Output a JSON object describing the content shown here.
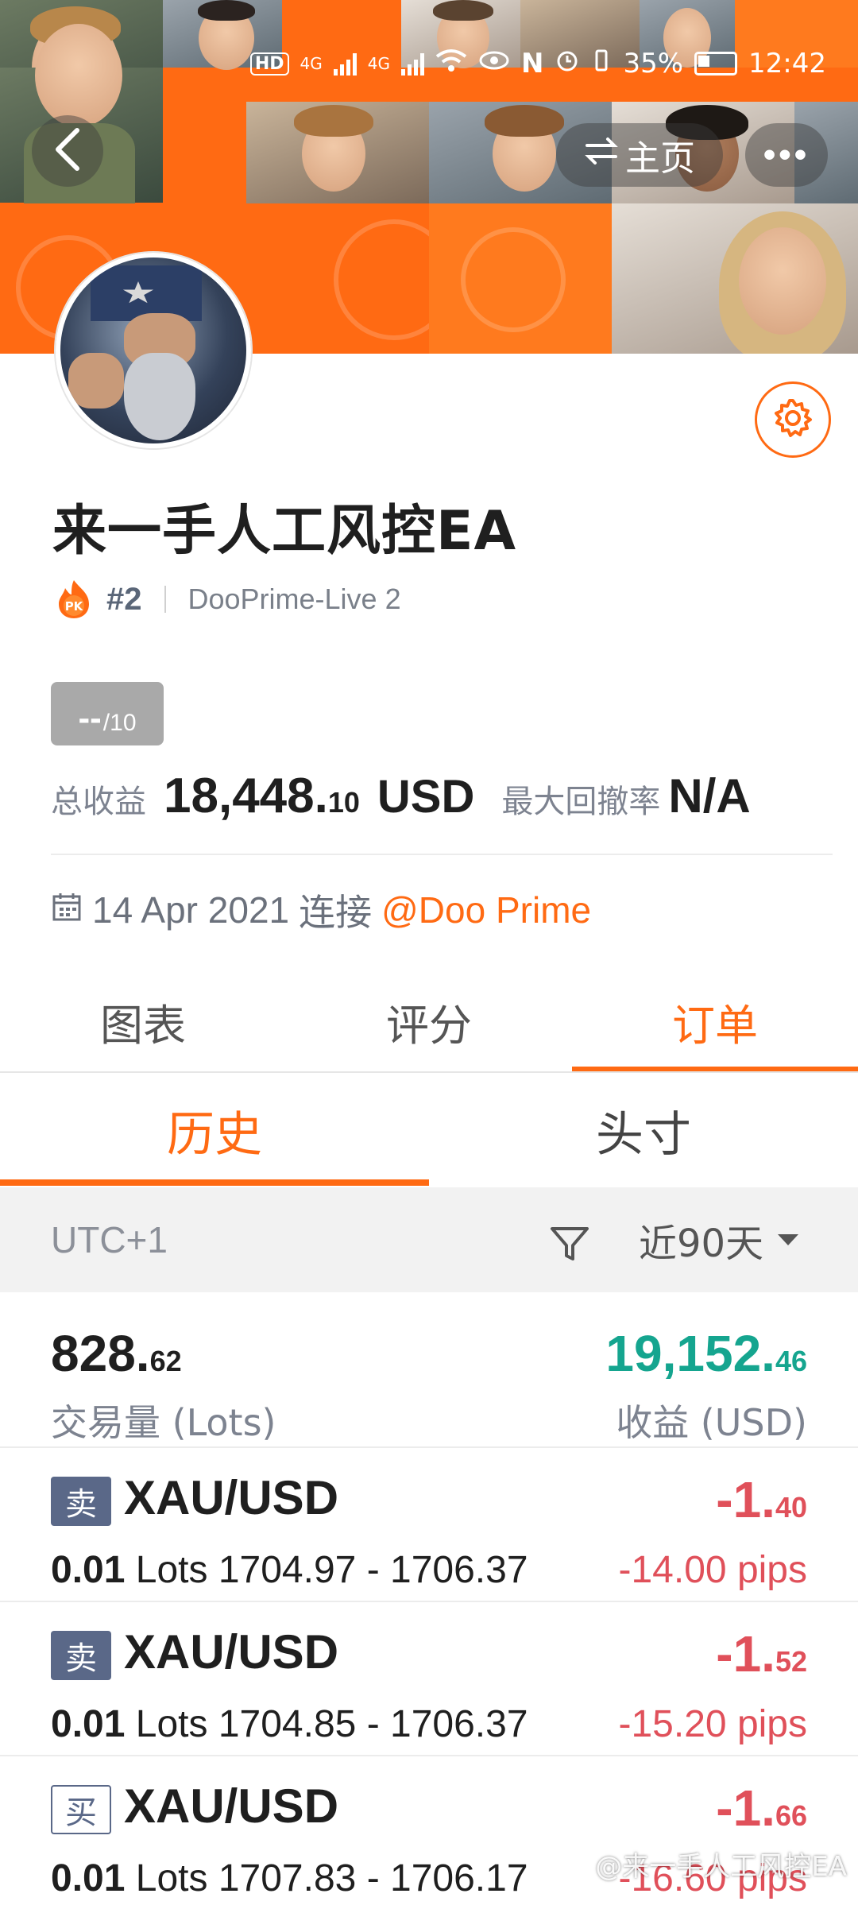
{
  "status_bar": {
    "hd": "HD",
    "sim1": "4G",
    "sim2": "4G",
    "nfc": "N",
    "battery": "35%",
    "time": "12:42"
  },
  "header": {
    "home_label": "主页",
    "more_label": "•••"
  },
  "profile": {
    "name": "来一手人工风控EA",
    "rank": "#2",
    "server": "DooPrime-Live 2",
    "score_value": "--",
    "score_max": "/10",
    "total_profit_label": "总收益",
    "total_profit_int": "18,448.",
    "total_profit_frac": "10",
    "total_profit_unit": "USD",
    "max_drawdown_label": "最大回撤率",
    "max_drawdown_value": "N/A",
    "connect_date": "14 Apr 2021",
    "connect_label": "连接",
    "connect_broker": "@Doo Prime"
  },
  "tabs": {
    "main": [
      "图表",
      "评分",
      "订单"
    ],
    "active_main": 2,
    "sub": [
      "历史",
      "头寸"
    ],
    "active_sub": 0
  },
  "filter": {
    "timezone": "UTC+1",
    "range": "近90天"
  },
  "summary": {
    "volume_int": "828.",
    "volume_frac": "62",
    "volume_label": "交易量 (Lots)",
    "profit_int": "19,152.",
    "profit_frac": "46",
    "profit_label": "收益 (USD)"
  },
  "orders": [
    {
      "side": "卖",
      "symbol": "XAU/USD",
      "lots": "0.01",
      "lots_unit": "Lots",
      "prices": "1704.97 - 1706.37",
      "profit_int": "-1.",
      "profit_frac": "40",
      "pips": "-14.00 pips"
    },
    {
      "side": "卖",
      "symbol": "XAU/USD",
      "lots": "0.01",
      "lots_unit": "Lots",
      "prices": "1704.85 - 1706.37",
      "profit_int": "-1.",
      "profit_frac": "52",
      "pips": "-15.20 pips"
    },
    {
      "side": "买",
      "symbol": "XAU/USD",
      "lots": "0.01",
      "lots_unit": "Lots",
      "prices": "1707.83 - 1706.17",
      "profit_int": "-1.",
      "profit_frac": "66",
      "pips": "-16.60 pips"
    }
  ],
  "watermark": "@来一手人工风控EA",
  "colors": {
    "accent": "#ff6a13",
    "positive": "#15a58f",
    "negative": "#e0505a",
    "sell_badge": "#5a6888"
  }
}
